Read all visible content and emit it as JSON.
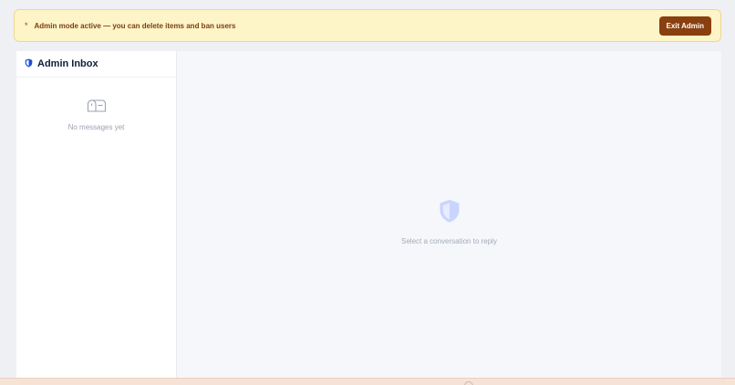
{
  "banner": {
    "icon": "asterisk",
    "text": "Admin mode active — you can delete items and ban users",
    "exit_label": "Exit Admin",
    "background": "#fdf4c7",
    "button_color": "#8a3f0f"
  },
  "sidebar": {
    "title": "Admin Inbox",
    "title_icon": "shield-icon",
    "empty_icon": "mailbox-icon",
    "empty_text": "No messages yet"
  },
  "main": {
    "empty_icon": "shield-icon",
    "empty_text": "Select a conversation to reply"
  },
  "colors": {
    "accent": "#1d4ed8",
    "shield_placeholder": "#c9d4ff"
  }
}
